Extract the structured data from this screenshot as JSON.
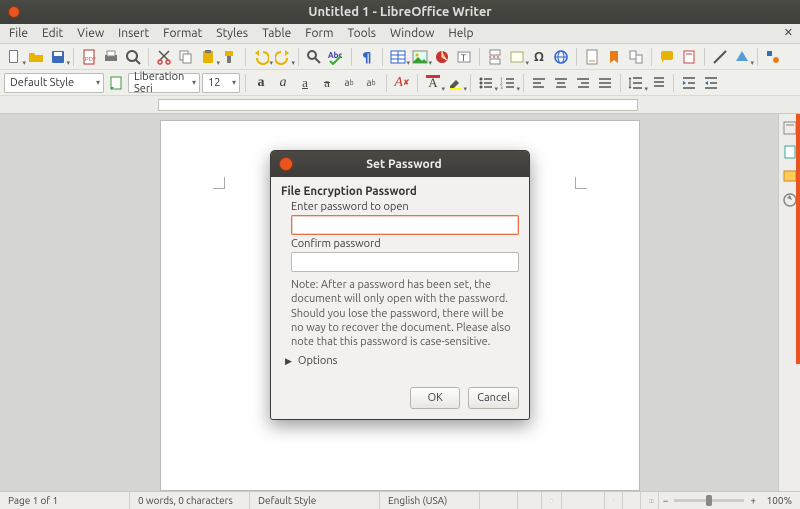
{
  "window": {
    "title": "Untitled 1 - LibreOffice Writer"
  },
  "menubar": [
    "File",
    "Edit",
    "View",
    "Insert",
    "Format",
    "Styles",
    "Table",
    "Form",
    "Tools",
    "Window",
    "Help"
  ],
  "format_toolbar": {
    "style": "Default Style",
    "font": "Liberation Seri",
    "size": "12"
  },
  "dialog": {
    "title": "Set Password",
    "group": "File Encryption Password",
    "enter_label": "Enter password to open",
    "confirm_label": "Confirm password",
    "note": "Note: After a password has been set, the document will only open with the password. Should you lose the password, there will be no way to recover the document. Please also note that this password is case-sensitive.",
    "options": "Options",
    "ok": "OK",
    "cancel": "Cancel"
  },
  "statusbar": {
    "page": "Page 1 of 1",
    "words": "0 words, 0 characters",
    "style": "Default Style",
    "lang": "English (USA)",
    "zoom": "100%"
  }
}
